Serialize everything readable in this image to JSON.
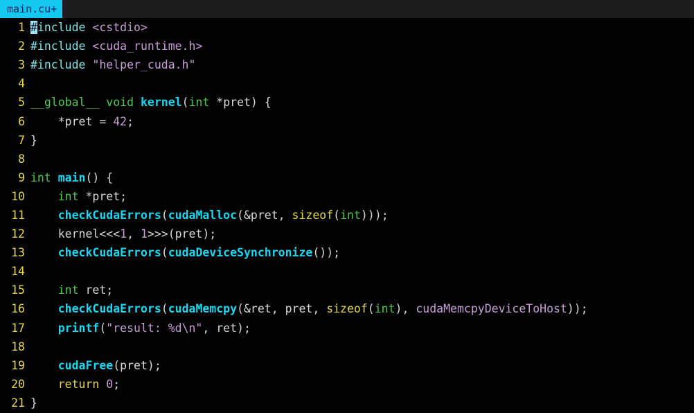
{
  "window": {
    "app": "terminal-text-editor",
    "theme": "dark",
    "colors": {
      "background": "#000000",
      "tabbar_background": "#1c1c1c",
      "tab_active_background": "#13c9f2",
      "tab_active_text": "#13205c",
      "line_number": "#e6d84a",
      "plain_text": "#d8d8d8",
      "preprocessor": "#7fe3e8",
      "string": "#c79fd6",
      "number": "#c79fd6",
      "constant": "#c79fd6",
      "type_keyword": "#4ec94e",
      "keyword": "#e6d84a",
      "function": "#18d7ef",
      "cursor": "#9fe4f7"
    }
  },
  "tabbar": {
    "tabs": [
      {
        "label": "main.cu+",
        "active": true,
        "modified": true
      }
    ]
  },
  "editor": {
    "language": "cuda-cpp",
    "cursor": {
      "line": 1,
      "column": 1
    },
    "total_lines": 21,
    "lines": [
      {
        "number": "1",
        "tokens": [
          {
            "text": "#",
            "cls": "t-pre cursor"
          },
          {
            "text": "include",
            "cls": "t-pre"
          },
          {
            "text": " ",
            "cls": "t-plain"
          },
          {
            "text": "<cstdio>",
            "cls": "t-header"
          }
        ]
      },
      {
        "number": "2",
        "tokens": [
          {
            "text": "#include",
            "cls": "t-pre"
          },
          {
            "text": " ",
            "cls": "t-plain"
          },
          {
            "text": "<cuda_runtime.h>",
            "cls": "t-header"
          }
        ]
      },
      {
        "number": "3",
        "tokens": [
          {
            "text": "#include",
            "cls": "t-pre"
          },
          {
            "text": " ",
            "cls": "t-plain"
          },
          {
            "text": "\"helper_cuda.h\"",
            "cls": "t-header"
          }
        ]
      },
      {
        "number": "4",
        "tokens": []
      },
      {
        "number": "5",
        "tokens": [
          {
            "text": "__global__",
            "cls": "t-type"
          },
          {
            "text": " ",
            "cls": "t-plain"
          },
          {
            "text": "void",
            "cls": "t-type"
          },
          {
            "text": " ",
            "cls": "t-plain"
          },
          {
            "text": "kernel",
            "cls": "t-fn"
          },
          {
            "text": "(",
            "cls": "t-punc"
          },
          {
            "text": "int",
            "cls": "t-type"
          },
          {
            "text": " *pret) {",
            "cls": "t-plain"
          }
        ]
      },
      {
        "number": "6",
        "tokens": [
          {
            "text": "    *pret = ",
            "cls": "t-plain"
          },
          {
            "text": "42",
            "cls": "t-num"
          },
          {
            "text": ";",
            "cls": "t-plain"
          }
        ]
      },
      {
        "number": "7",
        "tokens": [
          {
            "text": "}",
            "cls": "t-plain"
          }
        ]
      },
      {
        "number": "8",
        "tokens": []
      },
      {
        "number": "9",
        "tokens": [
          {
            "text": "int",
            "cls": "t-type"
          },
          {
            "text": " ",
            "cls": "t-plain"
          },
          {
            "text": "main",
            "cls": "t-fn"
          },
          {
            "text": "() {",
            "cls": "t-plain"
          }
        ]
      },
      {
        "number": "10",
        "tokens": [
          {
            "text": "    ",
            "cls": "t-plain"
          },
          {
            "text": "int",
            "cls": "t-type"
          },
          {
            "text": " *pret;",
            "cls": "t-plain"
          }
        ]
      },
      {
        "number": "11",
        "tokens": [
          {
            "text": "    ",
            "cls": "t-plain"
          },
          {
            "text": "checkCudaErrors",
            "cls": "t-fn"
          },
          {
            "text": "(",
            "cls": "t-punc"
          },
          {
            "text": "cudaMalloc",
            "cls": "t-fn"
          },
          {
            "text": "(&pret, ",
            "cls": "t-plain"
          },
          {
            "text": "sizeof",
            "cls": "t-kw"
          },
          {
            "text": "(",
            "cls": "t-punc"
          },
          {
            "text": "int",
            "cls": "t-type"
          },
          {
            "text": ")));",
            "cls": "t-plain"
          }
        ]
      },
      {
        "number": "12",
        "tokens": [
          {
            "text": "    kernel<<<",
            "cls": "t-plain"
          },
          {
            "text": "1",
            "cls": "t-num"
          },
          {
            "text": ", ",
            "cls": "t-plain"
          },
          {
            "text": "1",
            "cls": "t-num"
          },
          {
            "text": ">>>(pret);",
            "cls": "t-plain"
          }
        ]
      },
      {
        "number": "13",
        "tokens": [
          {
            "text": "    ",
            "cls": "t-plain"
          },
          {
            "text": "checkCudaErrors",
            "cls": "t-fn"
          },
          {
            "text": "(",
            "cls": "t-punc"
          },
          {
            "text": "cudaDeviceSynchronize",
            "cls": "t-fn"
          },
          {
            "text": "());",
            "cls": "t-plain"
          }
        ]
      },
      {
        "number": "14",
        "tokens": []
      },
      {
        "number": "15",
        "tokens": [
          {
            "text": "    ",
            "cls": "t-plain"
          },
          {
            "text": "int",
            "cls": "t-type"
          },
          {
            "text": " ret;",
            "cls": "t-plain"
          }
        ]
      },
      {
        "number": "16",
        "tokens": [
          {
            "text": "    ",
            "cls": "t-plain"
          },
          {
            "text": "checkCudaErrors",
            "cls": "t-fn"
          },
          {
            "text": "(",
            "cls": "t-punc"
          },
          {
            "text": "cudaMemcpy",
            "cls": "t-fn"
          },
          {
            "text": "(&ret, pret, ",
            "cls": "t-plain"
          },
          {
            "text": "sizeof",
            "cls": "t-kw"
          },
          {
            "text": "(",
            "cls": "t-punc"
          },
          {
            "text": "int",
            "cls": "t-type"
          },
          {
            "text": "), ",
            "cls": "t-plain"
          },
          {
            "text": "cudaMemcpyDeviceToHost",
            "cls": "t-const"
          },
          {
            "text": "));",
            "cls": "t-plain"
          }
        ]
      },
      {
        "number": "17",
        "tokens": [
          {
            "text": "    ",
            "cls": "t-plain"
          },
          {
            "text": "printf",
            "cls": "t-fn"
          },
          {
            "text": "(",
            "cls": "t-punc"
          },
          {
            "text": "\"result: %d\\n\"",
            "cls": "t-string"
          },
          {
            "text": ", ret);",
            "cls": "t-plain"
          }
        ]
      },
      {
        "number": "18",
        "tokens": []
      },
      {
        "number": "19",
        "tokens": [
          {
            "text": "    ",
            "cls": "t-plain"
          },
          {
            "text": "cudaFree",
            "cls": "t-fn"
          },
          {
            "text": "(pret);",
            "cls": "t-plain"
          }
        ]
      },
      {
        "number": "20",
        "tokens": [
          {
            "text": "    ",
            "cls": "t-plain"
          },
          {
            "text": "return",
            "cls": "t-kw"
          },
          {
            "text": " ",
            "cls": "t-plain"
          },
          {
            "text": "0",
            "cls": "t-num"
          },
          {
            "text": ";",
            "cls": "t-plain"
          }
        ]
      },
      {
        "number": "21",
        "tokens": [
          {
            "text": "}",
            "cls": "t-plain"
          }
        ]
      }
    ]
  }
}
